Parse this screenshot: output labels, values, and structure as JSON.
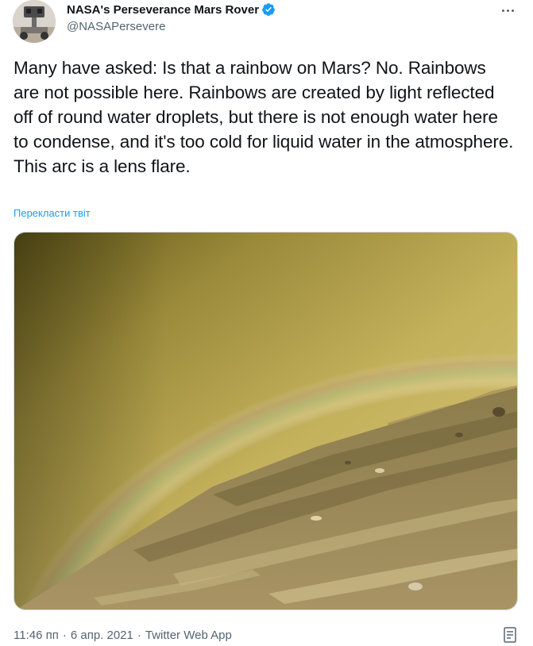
{
  "author": {
    "display_name": "NASA's Perseverance Mars Rover",
    "handle": "@NASAPersevere",
    "verified": true,
    "avatar_icon": "rover-avatar-icon"
  },
  "tweet": {
    "text": "Many have asked: Is that a rainbow on Mars? No. Rainbows are not possible here. Rainbows are created by light reflected off of round water droplets, but there is not enough water here to condense, and it's too cold for liquid water in the atmosphere. This arc is a lens flare.",
    "translate_label": "Перекласти твіт",
    "time": "11:46 пп",
    "date": "6 апр. 2021",
    "separator": "·",
    "source": "Twitter Web App"
  },
  "colors": {
    "link": "#1d9bf0",
    "verified_badge": "#1d9bf0",
    "secondary_text": "#536471",
    "primary_text": "#0f1419",
    "mars_sky": "#c9b55a",
    "mars_ground": "#8a7a45"
  },
  "icons": {
    "more": "more-dots-icon",
    "verified": "verified-badge-icon",
    "analytics": "analytics-icon"
  }
}
